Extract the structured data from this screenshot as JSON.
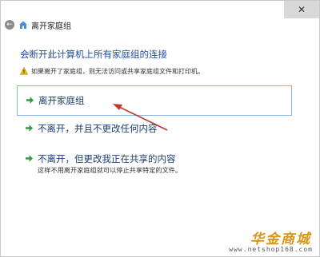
{
  "window": {
    "back_icon": "back-arrow-icon",
    "home_icon": "homegroup-icon",
    "title": "离开家庭组",
    "close_label": "✕"
  },
  "main": {
    "heading": "会断开此计算机上所有家庭组的连接",
    "warning_icon": "warning-icon",
    "warning_text": "如果离开了家庭组，则无法访问或共享家庭组文件和打印机。",
    "options": [
      {
        "label": "离开家庭组",
        "sub": "",
        "icon": "green-arrow-icon",
        "selected": true
      },
      {
        "label": "不离开，并且不更改任何内容",
        "sub": "",
        "icon": "green-arrow-icon",
        "selected": false
      },
      {
        "label": "不离开，但更改我正在共享的内容",
        "sub": "这样不用离开家庭组就可以停止共享特定的文件。",
        "icon": "green-arrow-icon",
        "selected": false
      }
    ]
  },
  "watermark": {
    "brand": "华金商城",
    "url": "www.netshop168.com"
  },
  "colors": {
    "heading": "#1f4e99",
    "selected_border": "#7eb4ea",
    "annotation": "#c0392b",
    "watermark": "#d79516"
  }
}
